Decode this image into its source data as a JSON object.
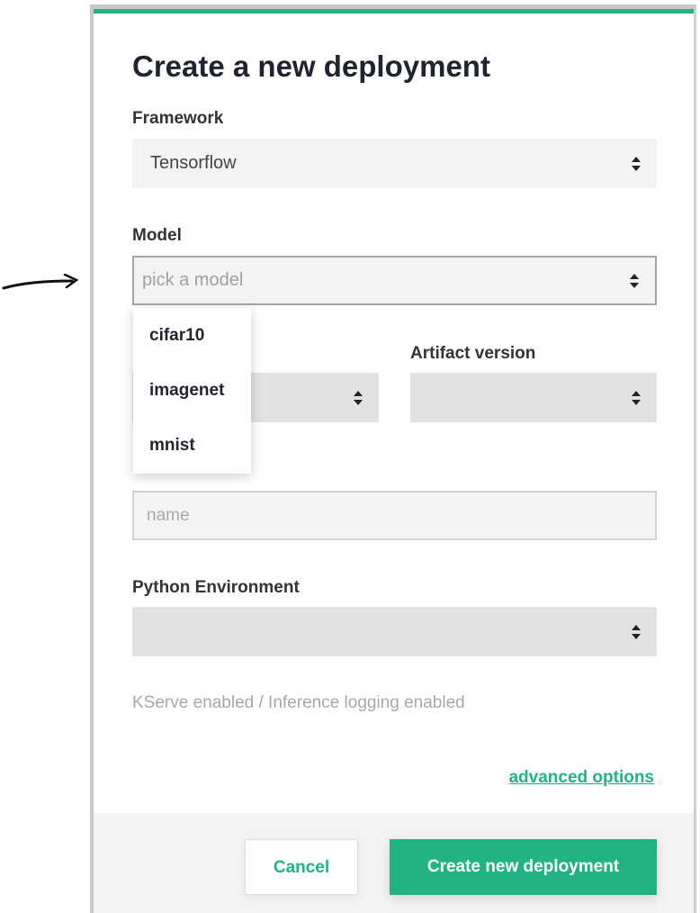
{
  "modal": {
    "title": "Create a new deployment",
    "framework": {
      "label": "Framework",
      "value": "Tensorflow"
    },
    "model": {
      "label": "Model",
      "placeholder": "pick a model",
      "options": [
        "cifar10",
        "imagenet",
        "mnist"
      ]
    },
    "artifact_version": {
      "label": "Artifact version",
      "value": ""
    },
    "name": {
      "placeholder": "name"
    },
    "python_environment": {
      "label": "Python Environment",
      "value": ""
    },
    "info_text": "KServe enabled / Inference logging enabled",
    "advanced_options": "advanced options",
    "cancel_label": "Cancel",
    "create_label": "Create new deployment"
  },
  "colors": {
    "accent": "#21b384"
  }
}
